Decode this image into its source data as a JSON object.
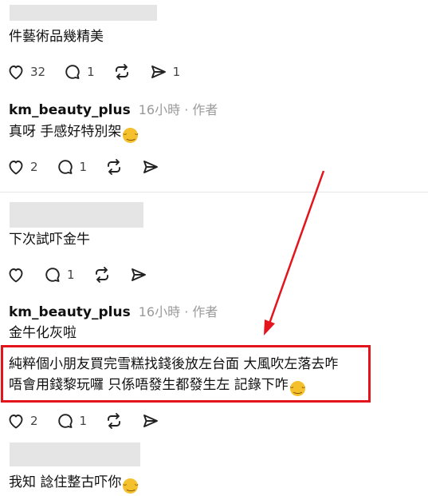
{
  "comments": [
    {
      "username_hidden": true,
      "text": "件藝術品幾精美",
      "likes": "32",
      "replies": "1",
      "shares": "1"
    },
    {
      "username": "km_beauty_plus",
      "time": "16小時",
      "separator": "·",
      "author_tag": "作者",
      "text": "真呀 手感好特別架",
      "likes": "2",
      "replies": "1"
    },
    {
      "username_hidden": true,
      "text": "下次試吓金牛",
      "replies": "1"
    },
    {
      "username": "km_beauty_plus",
      "time": "16小時",
      "separator": "·",
      "author_tag": "作者",
      "text": "金牛化灰啦",
      "highlighted_lines": [
        "純粹個小朋友買完雪糕找錢後放左台面 大風吹左落去咋",
        "唔會用錢黎玩囉 只係唔發生都發生左 記錄下咋"
      ],
      "likes": "2",
      "replies": "1"
    },
    {
      "username_hidden": true,
      "text": "我知 諗住整古吓你"
    }
  ],
  "icons": {
    "like": "heart-icon",
    "reply": "comment-bubble-icon",
    "repost": "repost-icon",
    "share": "send-icon",
    "emoji": "yum-face-emoji"
  },
  "colors": {
    "highlight_border": "#e3141c",
    "annotation_arrow": "#e3141c",
    "meta_text": "#9a9a9a"
  }
}
